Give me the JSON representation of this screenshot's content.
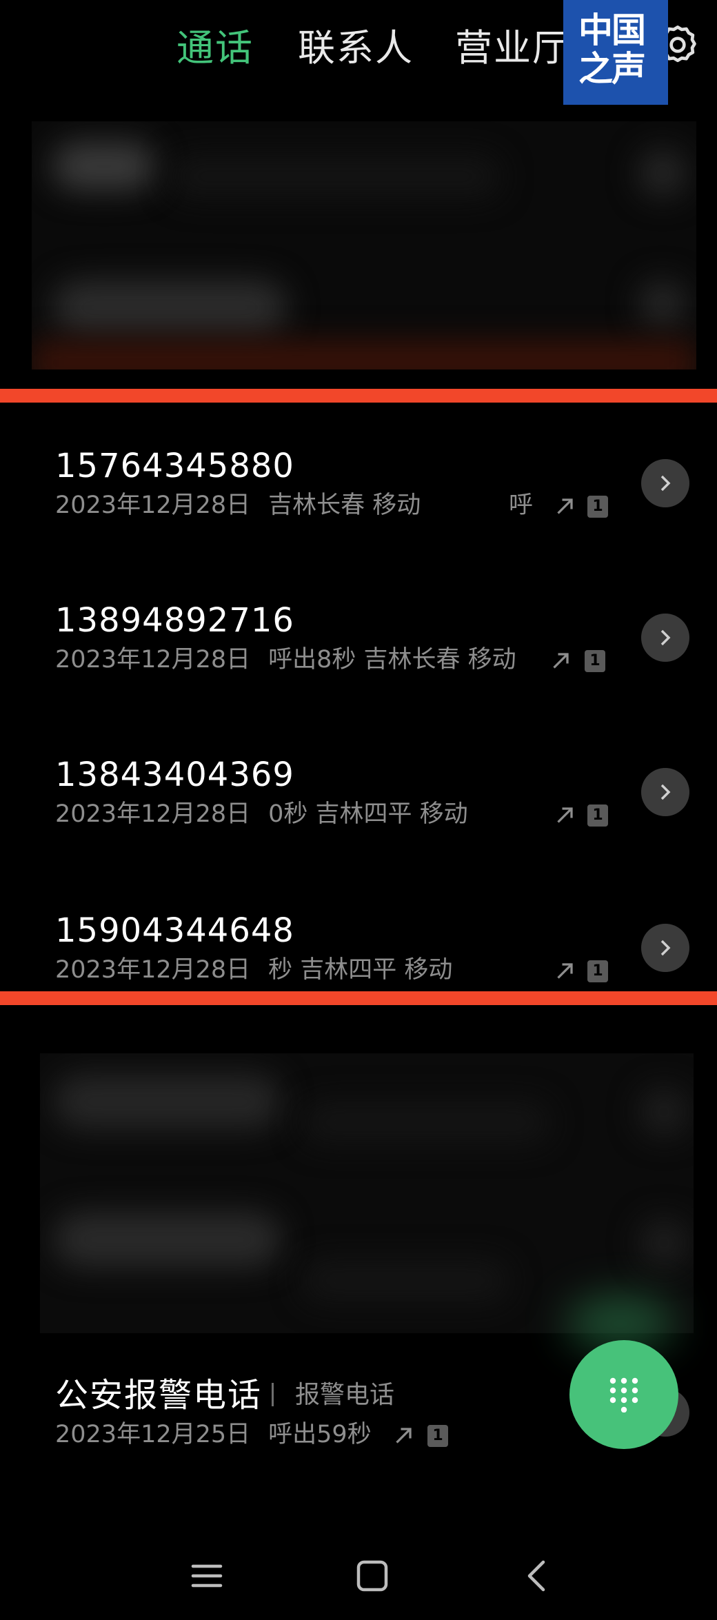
{
  "tabs": {
    "calls": "通话",
    "contacts": "联系人",
    "service_hall": "营业厅"
  },
  "logo": {
    "line1": "中国",
    "line2": "之声"
  },
  "calls": [
    {
      "number": "15764345880",
      "date": "2023年12月28日",
      "detail": "吉林长春 移动",
      "extra": "呼",
      "sim": "1"
    },
    {
      "number": "13894892716",
      "date": "2023年12月28日",
      "detail": "呼出8秒 吉林长春 移动",
      "sim": "1"
    },
    {
      "number": "13843404369",
      "date": "2023年12月28日",
      "detail": "0秒 吉林四平 移动",
      "sim": "1"
    },
    {
      "number": "15904344648",
      "date": "2023年12月28日",
      "detail": "秒 吉林四平 移动",
      "sim": "1"
    }
  ],
  "police_call": {
    "name": "公安报警电话",
    "tag": "报警电话",
    "date": "2023年12月25日",
    "detail": "呼出59秒",
    "sim": "1"
  },
  "colors": {
    "accent": "#43c47a",
    "highlight": "#f2472a",
    "logo_bg": "#1d52ad",
    "fab": "#47c27a"
  },
  "icons": {
    "settings": "gear-icon",
    "row_action": "chevron-right-icon",
    "call_direction": "outgoing-arrow-icon",
    "fab": "dialpad-icon",
    "nav": [
      "menu-icon",
      "home-icon",
      "back-icon"
    ]
  }
}
